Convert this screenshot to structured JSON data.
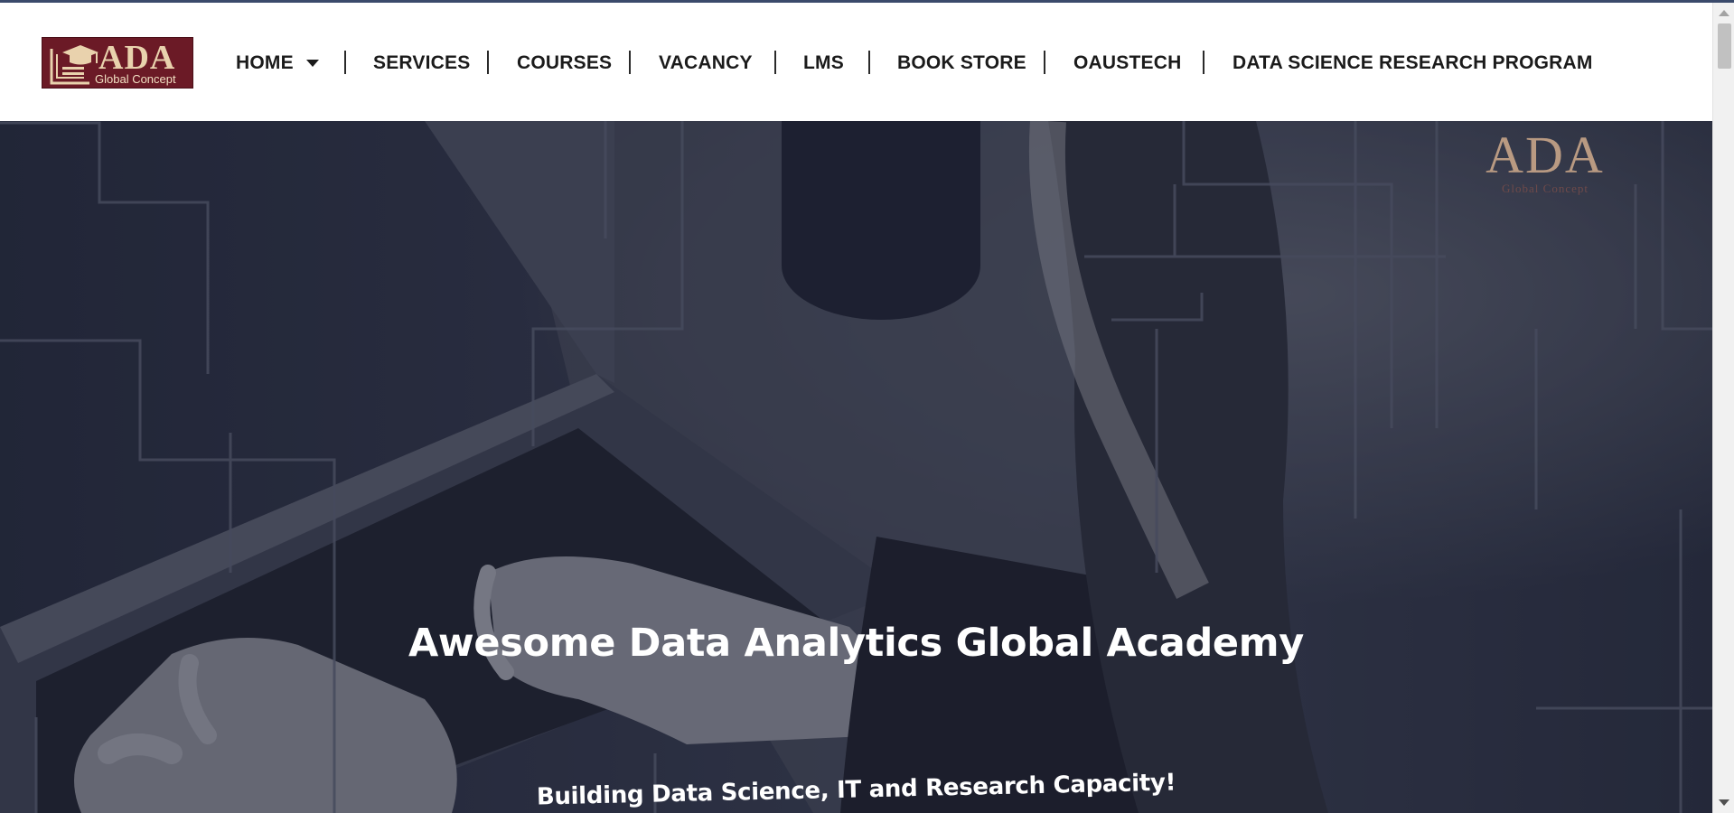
{
  "brand": {
    "logo_text": "ADA",
    "logo_subtext": "Global Concept"
  },
  "nav": {
    "home": "HOME",
    "services": "SERVICES",
    "courses": "COURSES",
    "vacancy": "VACANCY",
    "lms": "LMS",
    "book_store": "BOOK STORE",
    "oaustech": "OAUSTECH",
    "data_science": "DATA SCIENCE RESEARCH PROGRAM"
  },
  "hero": {
    "title": "Awesome Data Analytics Global Academy",
    "subtitle": "Building Data Science, IT and Research Capacity!",
    "watermark_text": "ADA",
    "watermark_subtext": "Global Concept"
  },
  "icons": {
    "logo_emblem": "graduation-cap-icon",
    "home_dropdown": "caret-down-icon"
  },
  "colors": {
    "brand_maroon": "#6b1a26",
    "brand_gold": "#e9d2ad",
    "hero_overlay": "#2b3040",
    "nav_text": "#1b1b1b"
  }
}
